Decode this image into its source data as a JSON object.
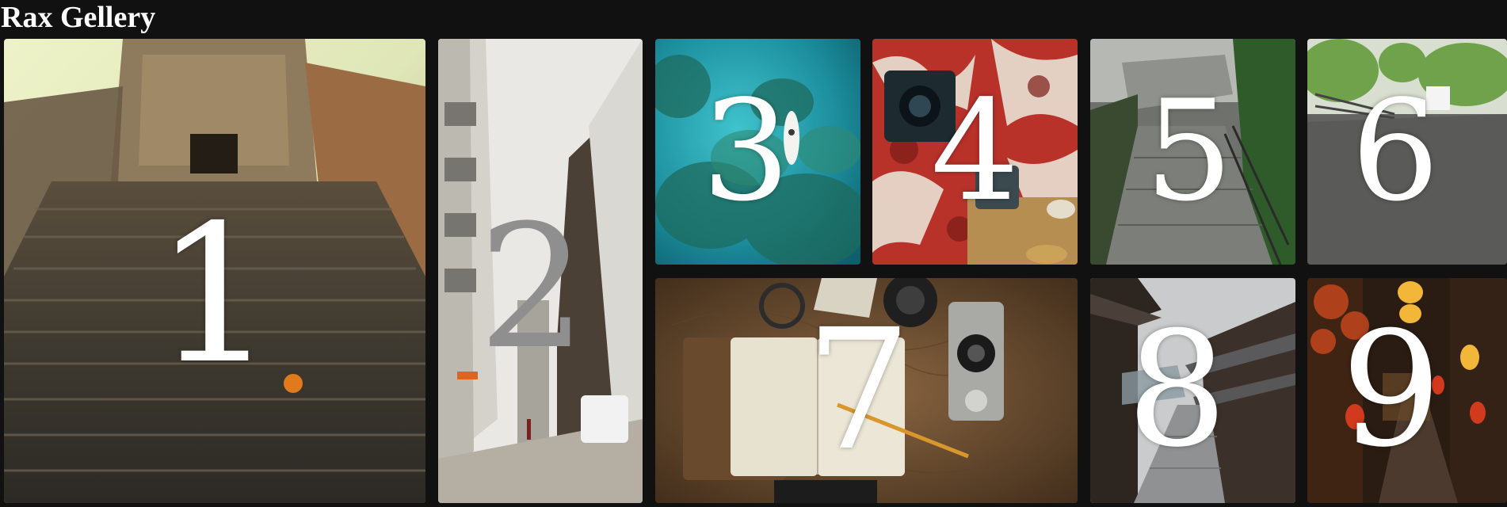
{
  "header": {
    "title": "Rax Gellery"
  },
  "gallery": {
    "tiles": [
      {
        "label": "1",
        "subject": "ancient stone temple staircase"
      },
      {
        "label": "2",
        "subject": "narrow city street between buildings"
      },
      {
        "label": "3",
        "subject": "aerial view of boat on turquoise sea"
      },
      {
        "label": "4",
        "subject": "camera on red floral fabric with tea cups"
      },
      {
        "label": "5",
        "subject": "stone alley path with railings"
      },
      {
        "label": "6",
        "subject": "blurred road with trees"
      },
      {
        "label": "7",
        "subject": "notebook, pencil, camera and map on desk"
      },
      {
        "label": "8",
        "subject": "traditional japanese street at dusk"
      },
      {
        "label": "9",
        "subject": "alley with hanging lanterns at night"
      }
    ]
  },
  "colors": {
    "page_background": "#111111",
    "title_text": "#ffffff",
    "number_text": "#ffffff",
    "number_text_muted": "#8f8f8f"
  }
}
